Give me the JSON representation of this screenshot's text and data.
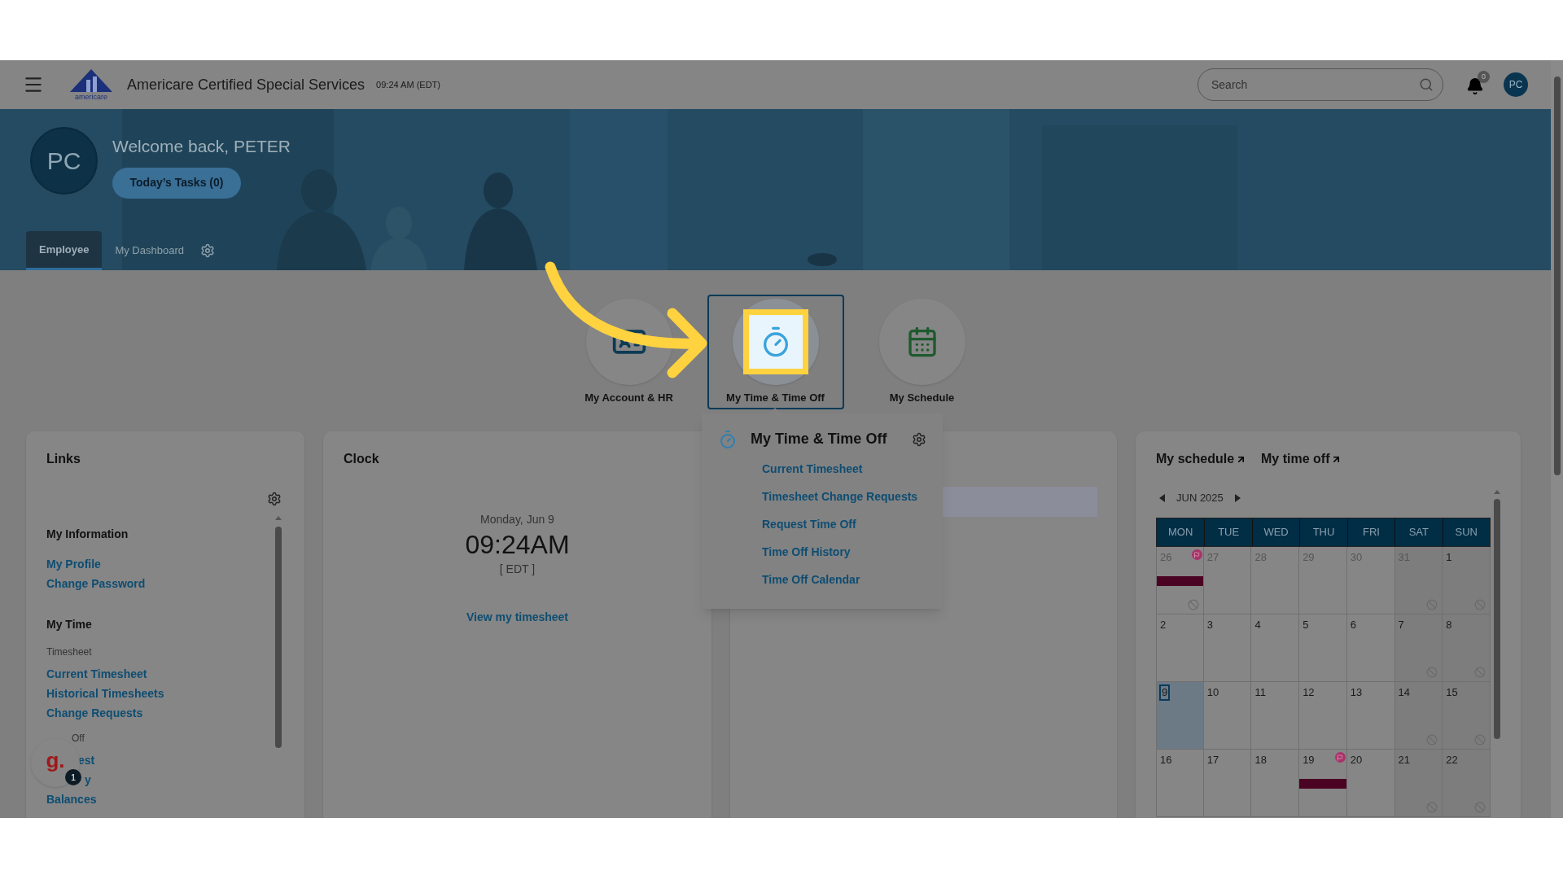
{
  "header": {
    "logo_text": "americare",
    "title": "Americare Certified Special Services",
    "time": "09:24 AM (EDT)",
    "search": {
      "placeholder": "Search"
    },
    "notifications": "0",
    "avatar": "PC"
  },
  "banner": {
    "avatar": "PC",
    "welcome": "Welcome back, PETER",
    "tasks_button": "Today’s Tasks (0)",
    "tabs": [
      {
        "label": "Employee",
        "selected": true
      },
      {
        "label": "My Dashboard",
        "selected": false
      }
    ]
  },
  "tiles": [
    {
      "label": "My Account & HR",
      "selected": false,
      "kind": "account"
    },
    {
      "label": "My Time & Time Off",
      "selected": true,
      "kind": "time"
    },
    {
      "label": "My Schedule",
      "selected": false,
      "kind": "schedule"
    }
  ],
  "popup": {
    "title": "My Time & Time Off",
    "links": [
      "Current Timesheet",
      "Timesheet Change Requests",
      "Request Time Off",
      "Time Off History",
      "Time Off Calendar"
    ]
  },
  "links_card": {
    "title": "Links",
    "sections": [
      {
        "heading": "My Information",
        "groups": [
          {
            "links": [
              "My Profile",
              "Change Password"
            ]
          }
        ]
      },
      {
        "heading": "My Time",
        "groups": [
          {
            "label": "Timesheet",
            "links": [
              "Current Timesheet",
              "Historical Timesheets",
              "Change Requests"
            ]
          },
          {
            "label": "Off",
            "links": [
              "est",
              "y",
              "Balances"
            ]
          }
        ]
      }
    ]
  },
  "clock_card": {
    "title": "Clock",
    "date": "Monday, Jun 9",
    "time": "09:24AM",
    "zone": "[ EDT ]",
    "link": "View my timesheet"
  },
  "schedule_card": {
    "links": [
      "My schedule",
      "My time off"
    ],
    "month": "JUN 2025",
    "weekdays": [
      "MON",
      "TUE",
      "WED",
      "THU",
      "FRI",
      "SAT",
      "SUN"
    ],
    "weeks": [
      [
        {
          "day": "26",
          "outside": true,
          "selected": false,
          "flag": true,
          "event": true,
          "blocked": true
        },
        {
          "day": "27",
          "outside": true,
          "selected": false,
          "flag": false,
          "event": false,
          "blocked": false
        },
        {
          "day": "28",
          "outside": true,
          "selected": false,
          "flag": false,
          "event": false,
          "blocked": false
        },
        {
          "day": "29",
          "outside": true,
          "selected": false,
          "flag": false,
          "event": false,
          "blocked": false
        },
        {
          "day": "30",
          "outside": true,
          "selected": false,
          "flag": false,
          "event": false,
          "blocked": false
        },
        {
          "day": "31",
          "outside": true,
          "selected": false,
          "flag": false,
          "event": false,
          "blocked": true
        },
        {
          "day": "1",
          "outside": false,
          "selected": false,
          "flag": false,
          "event": false,
          "blocked": true
        }
      ],
      [
        {
          "day": "2",
          "outside": false,
          "selected": false,
          "flag": false,
          "event": false,
          "blocked": false
        },
        {
          "day": "3",
          "outside": false,
          "selected": false,
          "flag": false,
          "event": false,
          "blocked": false
        },
        {
          "day": "4",
          "outside": false,
          "selected": false,
          "flag": false,
          "event": false,
          "blocked": false
        },
        {
          "day": "5",
          "outside": false,
          "selected": false,
          "flag": false,
          "event": false,
          "blocked": false
        },
        {
          "day": "6",
          "outside": false,
          "selected": false,
          "flag": false,
          "event": false,
          "blocked": false
        },
        {
          "day": "7",
          "outside": false,
          "selected": false,
          "flag": false,
          "event": false,
          "blocked": true
        },
        {
          "day": "8",
          "outside": false,
          "selected": false,
          "flag": false,
          "event": false,
          "blocked": true
        }
      ],
      [
        {
          "day": "9",
          "outside": false,
          "selected": true,
          "flag": false,
          "event": false,
          "blocked": false
        },
        {
          "day": "10",
          "outside": false,
          "selected": false,
          "flag": false,
          "event": false,
          "blocked": false
        },
        {
          "day": "11",
          "outside": false,
          "selected": false,
          "flag": false,
          "event": false,
          "blocked": false
        },
        {
          "day": "12",
          "outside": false,
          "selected": false,
          "flag": false,
          "event": false,
          "blocked": false
        },
        {
          "day": "13",
          "outside": false,
          "selected": false,
          "flag": false,
          "event": false,
          "blocked": false
        },
        {
          "day": "14",
          "outside": false,
          "selected": false,
          "flag": false,
          "event": false,
          "blocked": true
        },
        {
          "day": "15",
          "outside": false,
          "selected": false,
          "flag": false,
          "event": false,
          "blocked": true
        }
      ],
      [
        {
          "day": "16",
          "outside": false,
          "selected": false,
          "flag": false,
          "event": false,
          "blocked": false
        },
        {
          "day": "17",
          "outside": false,
          "selected": false,
          "flag": false,
          "event": false,
          "blocked": false
        },
        {
          "day": "18",
          "outside": false,
          "selected": false,
          "flag": false,
          "event": false,
          "blocked": false
        },
        {
          "day": "19",
          "outside": false,
          "selected": false,
          "flag": true,
          "event": true,
          "blocked": false
        },
        {
          "day": "20",
          "outside": false,
          "selected": false,
          "flag": false,
          "event": false,
          "blocked": false
        },
        {
          "day": "21",
          "outside": false,
          "selected": false,
          "flag": false,
          "event": false,
          "blocked": true
        },
        {
          "day": "22",
          "outside": false,
          "selected": false,
          "flag": false,
          "event": false,
          "blocked": true
        }
      ]
    ]
  },
  "chat_widget": {
    "logo": "g.",
    "badge": "1"
  }
}
